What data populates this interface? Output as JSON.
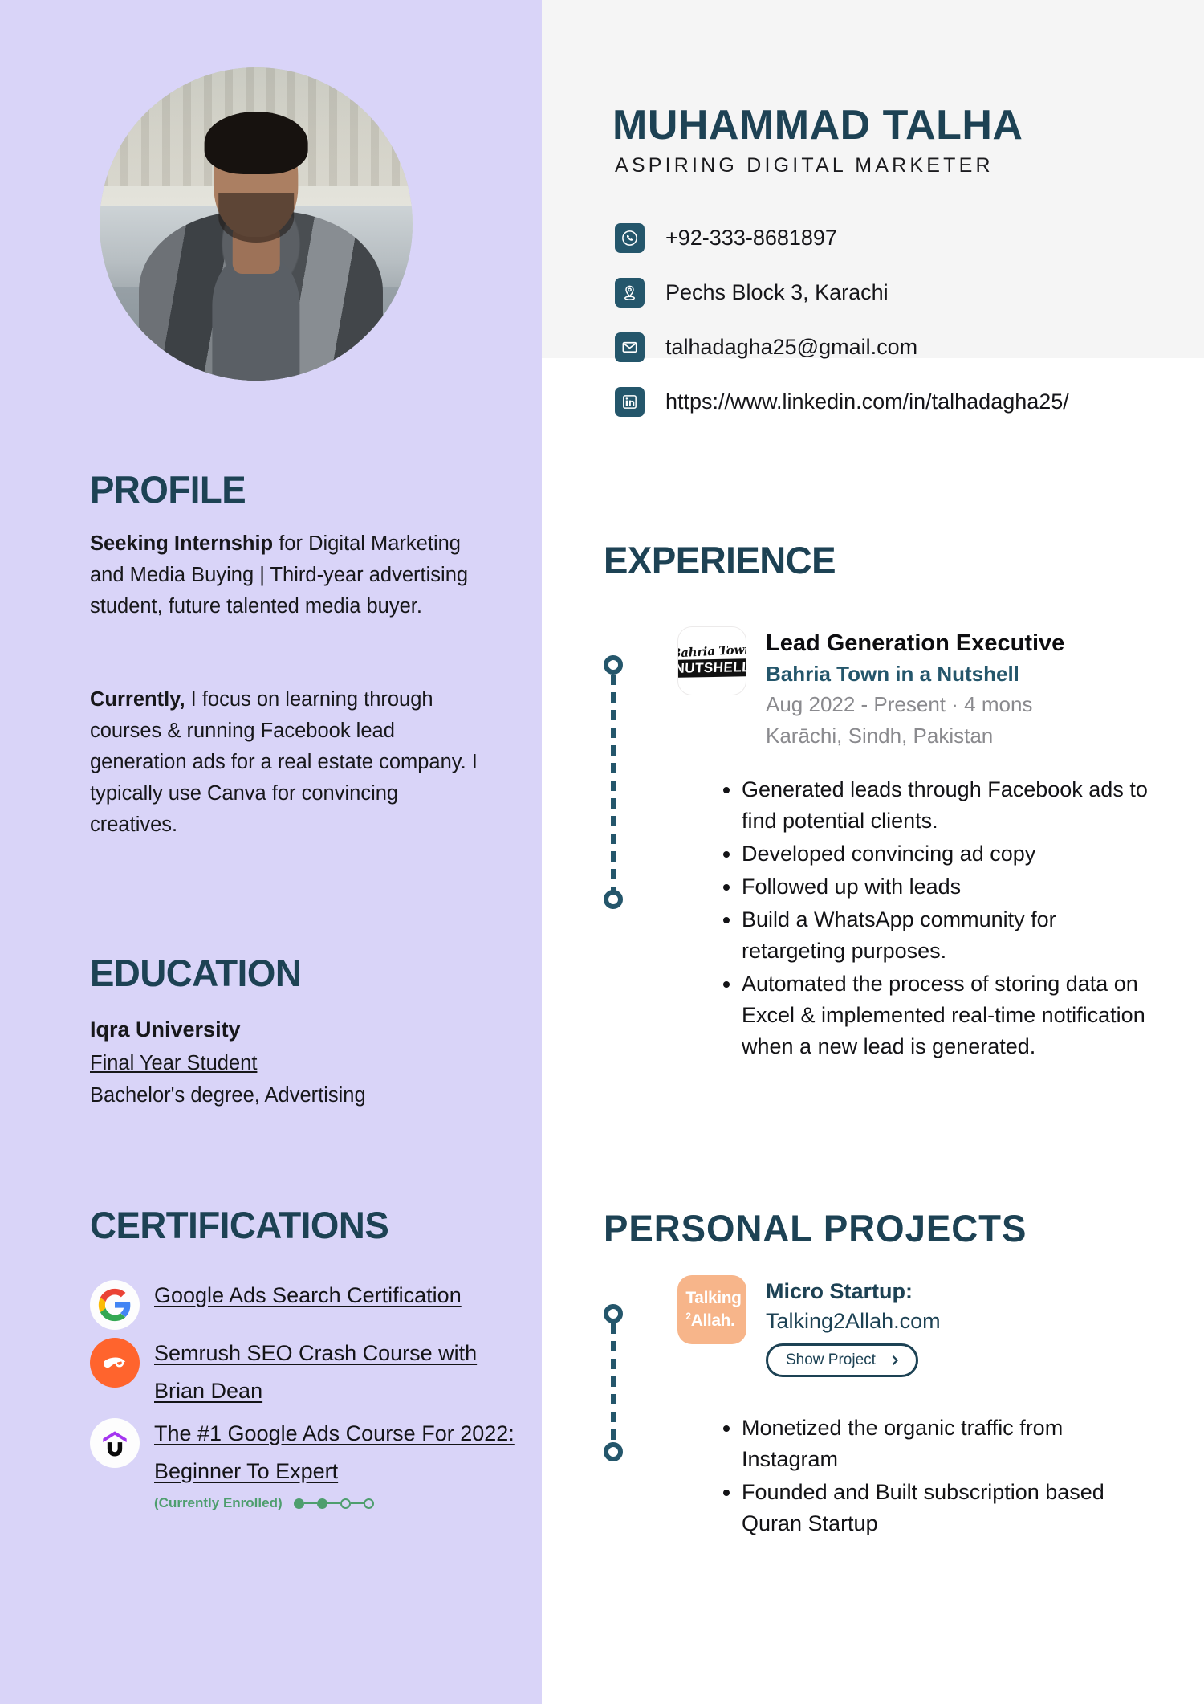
{
  "colors": {
    "sidebar_bg": "#D9D4F8",
    "header_panel_bg": "#F5F5F5",
    "heading": "#1D4254",
    "accent_teal": "#24566B",
    "enrolled_green": "#4E9E6E",
    "semrush_orange": "#FF642D",
    "talking_peach": "#F7B58A"
  },
  "header": {
    "name": "MUHAMMAD TALHA",
    "subtitle": "ASPIRING DIGITAL MARKETER",
    "photo_alt": "portrait-photo",
    "contacts": [
      {
        "icon": "phone-icon",
        "value": "+92-333-8681897"
      },
      {
        "icon": "location-pin-icon",
        "value": "Pechs Block 3, Karachi"
      },
      {
        "icon": "email-icon",
        "value": "talhadagha25@gmail.com"
      },
      {
        "icon": "linkedin-icon",
        "value": "https://www.linkedin.com/in/talhadagha25/"
      }
    ]
  },
  "sidebar": {
    "profile": {
      "heading": "PROFILE",
      "para1_bold": "Seeking Internship",
      "para1_rest": " for Digital Marketing and Media Buying | Third-year advertising student, future talented media buyer.",
      "para2_bold": "Currently,",
      "para2_rest": " I focus on learning through courses & running Facebook lead generation ads for a real estate company. I typically use Canva for convincing creatives."
    },
    "education": {
      "heading": "EDUCATION",
      "school": "Iqra University",
      "status": "Final Year Student",
      "degree": "Bachelor's degree, Advertising"
    },
    "certifications": {
      "heading": "CERTIFICATIONS",
      "items": [
        {
          "logo": "google-logo-icon",
          "title": "Google Ads Search Certification"
        },
        {
          "logo": "semrush-logo-icon",
          "title": "Semrush SEO Crash Course with Brian Dean"
        },
        {
          "logo": "udemy-logo-icon",
          "title": "The #1 Google Ads Course For 2022: Beginner To Expert",
          "status": "(Currently Enrolled)",
          "progress_filled": 2,
          "progress_total": 4
        }
      ]
    }
  },
  "experience": {
    "heading": "EXPERIENCE",
    "entries": [
      {
        "logo_line1": "Bahria Town",
        "logo_line2": "NUTSHELL",
        "role": "Lead Generation Executive",
        "company": "Bahria Town in a Nutshell",
        "dates": "Aug 2022 - Present · 4 mons",
        "location": "Karāchi, Sindh, Pakistan",
        "bullets": [
          "Generated leads through Facebook ads to find potential clients.",
          "Developed convincing ad copy",
          "Followed up with leads",
          "Build a WhatsApp community for retargeting purposes.",
          "Automated the process of storing data on Excel & implemented real-time notification when a new lead is generated."
        ]
      }
    ]
  },
  "projects": {
    "heading": "PERSONAL  PROJECTS",
    "entries": [
      {
        "logo_line1": "Talking",
        "logo_line2": "Allah.",
        "logo_sup": "2",
        "title": "Micro Startup:",
        "url": "Talking2Allah.com",
        "button_label": "Show Project",
        "button_icon": "chevron-right-icon",
        "bullets": [
          "Monetized the organic traffic from Instagram",
          "Founded and Built subscription based Quran Startup"
        ]
      }
    ]
  }
}
